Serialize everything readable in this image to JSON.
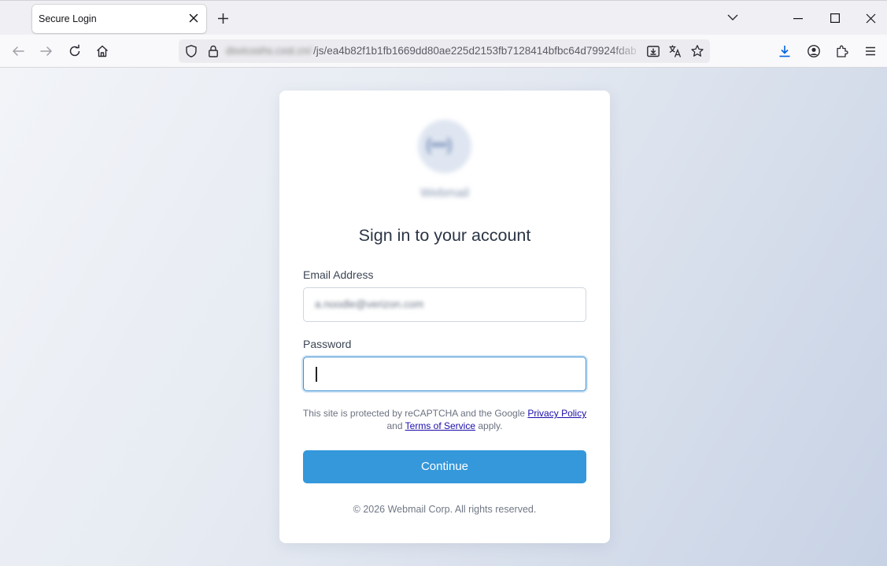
{
  "browser": {
    "tab": {
      "title": "Secure Login"
    },
    "url": {
      "domain": "dsvicoshs.cxst.cn/",
      "path": "/js/ea4b82f1b1fb1669dd80ae225d2153fb7128414bfbc64d79924fdab"
    },
    "icons": {
      "tab_close": "close-icon",
      "new_tab": "plus-icon",
      "tab_list": "chevron-down-icon",
      "back": "back-arrow-icon",
      "forward": "forward-arrow-icon",
      "reload": "reload-icon",
      "home": "home-icon",
      "shield": "shield-icon",
      "lock": "lock-icon",
      "install": "install-app-icon",
      "translate": "translate-icon",
      "bookmark": "star-icon",
      "downloads": "download-icon",
      "account": "account-icon",
      "extensions": "puzzle-icon",
      "menu": "hamburger-icon"
    }
  },
  "login": {
    "brand_name": "Webmail",
    "heading": "Sign in to your account",
    "email": {
      "label": "Email Address",
      "value": "a.noodle@verizon.com",
      "placeholder": ""
    },
    "password": {
      "label": "Password",
      "value": "",
      "placeholder": ""
    },
    "notice": {
      "prefix": "This site is protected by reCAPTCHA and the Google",
      "privacy_link": "Privacy Policy",
      "and": "and",
      "terms_link": "Terms of Service",
      "suffix": "apply."
    },
    "continue_button": "Continue",
    "footer": "© 2026 Webmail Corp. All rights reserved."
  },
  "colors": {
    "accent": "#3498db",
    "focus_border": "#3c8fd3",
    "link": "#1a0dab",
    "heading": "#2b3545"
  }
}
